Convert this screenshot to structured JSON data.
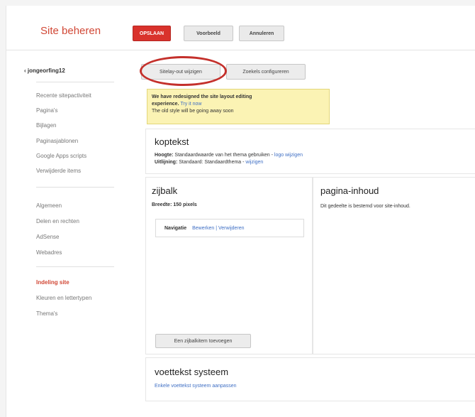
{
  "header": {
    "title": "Site beheren",
    "buttons": [
      "OPSLAAN",
      "Voorbeeld",
      "Annuleren"
    ]
  },
  "sidebar": {
    "site_name": "‹ jongeorfing12",
    "group1": [
      "Recente sitepactiviteit",
      "Pagina's",
      "Bijlagen",
      "Paginasjablonen",
      "Google Apps scripts",
      "Verwijderde items"
    ],
    "group2": [
      "Algemeen",
      "Delen en rechten",
      "AdSense",
      "Webadres"
    ],
    "group3": [
      "Indeling site",
      "Kleuren en lettertypen",
      "Thema's"
    ]
  },
  "toolbar": {
    "edit_layout": "Sitelay-out wijzigen",
    "configure_widths": "Zoekels configureren"
  },
  "notice": {
    "line1": "We have redesigned the site layout editing",
    "line2_bold": "experience.",
    "line2_link": "Try it now",
    "line3": "The old style will be going away soon"
  },
  "header_panel": {
    "heading": "koptekst",
    "height_label": "Hoogte:",
    "height_value": "Standaardwaarde van het thema gebruiken",
    "height_link": "logo wijzigen",
    "align_label": "Uitlijning:",
    "align_value": "Standaard: Standaardthema",
    "align_link": "wijzigen"
  },
  "sidebar_panel": {
    "heading": "zijbalk",
    "width_label": "Breedte:",
    "width_value": "150 pixels",
    "gadget_name": "Navigatie",
    "gadget_links": "Bewerken | Verwijderen",
    "add_button": "Een zijbalkitem toevoegen"
  },
  "content_panel": {
    "heading": "pagina-inhoud",
    "text": "Dit gedeelte is bestemd voor site-inhoud."
  },
  "footer_panel": {
    "heading": "voettekst systeem",
    "link": "Enkele voettekst systeem aanpassen"
  }
}
